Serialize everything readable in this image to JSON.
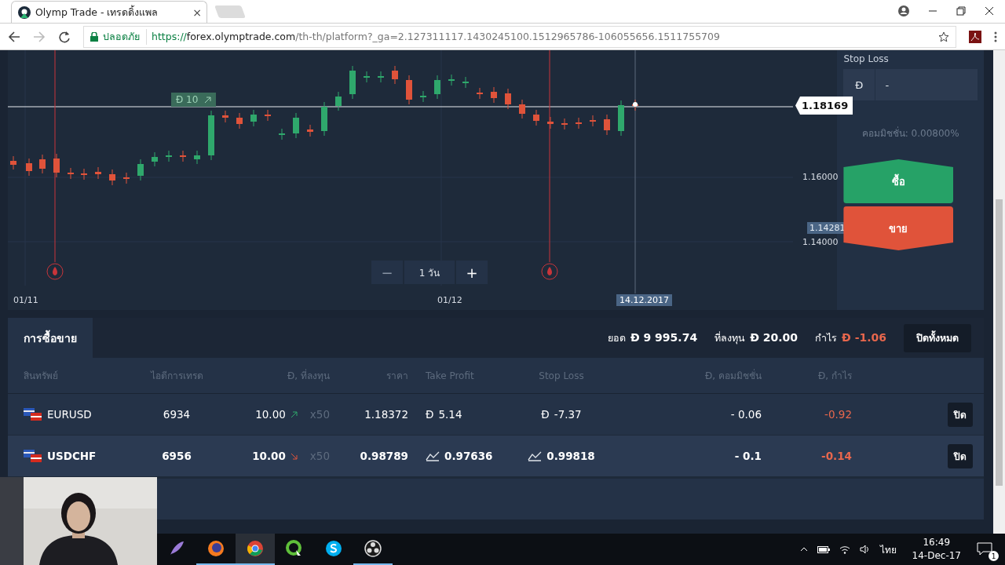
{
  "browser": {
    "tab_title": "Olymp Trade - เทรดดิ้งแพล",
    "close": "×",
    "secure_label": "ปลอดภัย",
    "url_scheme": "https://",
    "url_host": "forex.olymptrade.com",
    "url_path": "/th-th/platform?_ga=2.127311117.1430245100.1512965786-106055656.1511755709"
  },
  "chart": {
    "deal_badge": "Đ 10",
    "price_tag": "1.18169",
    "y_labels": [
      "1.16000",
      "1.14000"
    ],
    "low_tag": "1.14281",
    "zoom": {
      "minus": "−",
      "label": "1 วัน",
      "plus": "+"
    },
    "x_labels": [
      "01/11",
      "01/12"
    ],
    "current_date": "14.12.2017"
  },
  "order_panel": {
    "stop_loss_label": "Stop Loss",
    "stop_loss_currency": "Đ",
    "stop_loss_value": "-",
    "commission": "คอมมิชชั่น: 0.00800%",
    "buy": "ซื้อ",
    "sell": "ขาย"
  },
  "trades": {
    "tab": "การซื้อขาย",
    "balance_label": "ยอด",
    "balance": "Đ 9 995.74",
    "invested_label": "ที่ลงทุน",
    "invested": "Đ 20.00",
    "profit_label": "กำไร",
    "profit": "Đ -1.06",
    "close_all": "ปิดทั้งหมด",
    "columns": [
      "สินทรัพย์",
      "ไอดีการเทรด",
      "Đ, ที่ลงทุน",
      "ราคา",
      "Take Profit",
      "Stop Loss",
      "Đ, คอมมิชชั่น",
      "Đ, กำไร"
    ],
    "rows": [
      {
        "selected": false,
        "asset": "EURUSD",
        "id": "6934",
        "amount": "10.00",
        "rising": true,
        "multiplier": "x50",
        "price": "1.18372",
        "take_profit": {
          "kind": "amount",
          "prefix": "Đ",
          "value": "5.14"
        },
        "stop_loss": {
          "kind": "amount",
          "prefix": "Đ",
          "value": "-7.37"
        },
        "commission": "- 0.06",
        "profit": "-0.92",
        "close": "ปิด"
      },
      {
        "selected": true,
        "asset": "USDCHF",
        "id": "6956",
        "amount": "10.00",
        "rising": false,
        "multiplier": "x50",
        "price": "0.98789",
        "take_profit": {
          "kind": "rate",
          "value": "0.97636"
        },
        "stop_loss": {
          "kind": "rate",
          "value": "0.99818"
        },
        "commission": "- 0.1",
        "profit": "-0.14",
        "close": "ปิด"
      }
    ]
  },
  "taskbar": {
    "apps": [
      {
        "kind": "feather",
        "running": false,
        "selected": false
      },
      {
        "kind": "firefox",
        "running": true,
        "selected": false
      },
      {
        "kind": "chrome",
        "running": true,
        "selected": true
      },
      {
        "kind": "q",
        "running": false,
        "selected": false
      },
      {
        "kind": "skype",
        "running": false,
        "selected": false
      },
      {
        "kind": "obs",
        "running": true,
        "selected": false
      }
    ],
    "language": "ไทย",
    "time": "16:49",
    "date": "14-Dec-17",
    "notifications": "1"
  }
}
